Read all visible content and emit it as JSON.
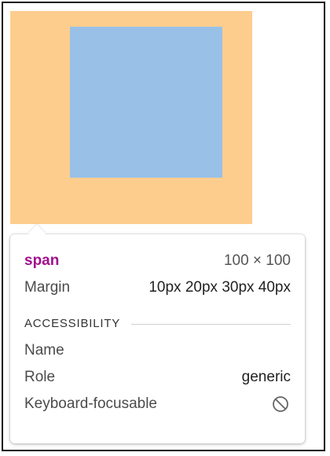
{
  "element": {
    "tag": "span",
    "dimensions": "100 × 100"
  },
  "margin": {
    "label": "Margin",
    "value": "10px 20px 30px 40px"
  },
  "accessibility": {
    "header": "ACCESSIBILITY",
    "name_label": "Name",
    "name_value": "",
    "role_label": "Role",
    "role_value": "generic",
    "focusable_label": "Keyboard-focusable",
    "focusable_icon": "not-allowed-icon"
  },
  "colors": {
    "margin_highlight": "#fdcd8e",
    "content_highlight": "#99c1e8",
    "tag_color": "#a0108d"
  }
}
